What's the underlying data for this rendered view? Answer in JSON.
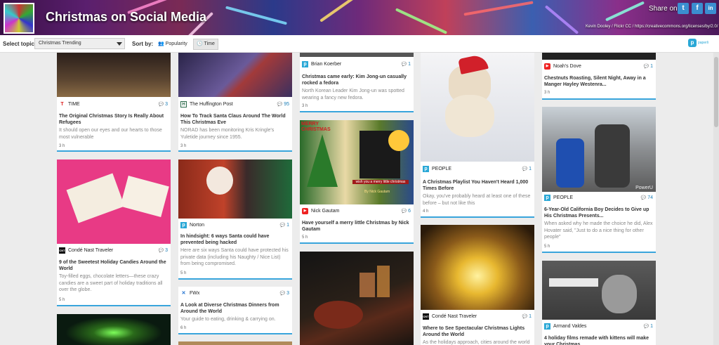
{
  "header": {
    "title": "Christmas on Social Media",
    "share_label": "Share on:",
    "share_buttons": [
      "t",
      "f",
      "in"
    ],
    "credit": "Kevin Dooley / Flickr CC / https://creativecommons.org/licenses/by/2.0/"
  },
  "controls": {
    "topic_label": "Select topic:",
    "topic_value": "Christmas Trending",
    "sort_label": "Sort by:",
    "sort_popularity": "Popularity",
    "sort_time": "Time",
    "brand": "paperli"
  },
  "cards": [
    {
      "source": "TIME",
      "count": "3",
      "title": "The Original Christmas Story Is Really About Refugees",
      "desc": "It should open our eyes and our hearts to those most vulnerable",
      "age": "3 h"
    },
    {
      "source": "The Huffington Post",
      "count": "95",
      "title": "How To Track Santa Claus Around The World This Christmas Eve",
      "desc": "NORAD has been monitoring Kris Kringle's Yuletide journey since 1955.",
      "age": "3 h"
    },
    {
      "source": "Brian Koerber",
      "count": "1",
      "title": "Christmas came early: Kim Jong-un casually rocked a fedora",
      "desc": "North Korean Leader Kim Jong-un was spotted wearing a fancy new fedora.",
      "age": "3 h"
    },
    {
      "source": "Noah's Dove",
      "count": "1",
      "title": "Chestnuts Roasting, Silent Night, Away in a Manger Hayley Westenra...",
      "desc": "",
      "age": "3 h"
    },
    {
      "source": "Condé Nast Traveler",
      "count": "3",
      "title": "9 of the Sweetest Holiday Candies Around the World",
      "desc": "Toy-filled eggs, chocolate letters—these crazy candies are a sweet part of holiday traditions all over the globe.",
      "age": "5 h"
    },
    {
      "source": "Norton",
      "count": "1",
      "title": "In hindsight: 6 ways Santa could have prevented being hacked",
      "desc": "Here are six ways Santa could have protected his private data (including his Naughty / Nice List) from being compromised.",
      "age": "5 h"
    },
    {
      "source": "FWx",
      "count": "3",
      "title": "A Look at Diverse Christmas Dinners from Around the World",
      "desc": "Your guide to eating, drinking & carrying on.",
      "age": "6 h"
    },
    {
      "source": "Nick Gautam",
      "count": "6",
      "title": "Have yourself a merry little Christmas by Nick Gautam",
      "desc": "",
      "age": "5 h"
    },
    {
      "source": "PEOPLE",
      "count": "1",
      "title": "A Christmas Playlist You Haven't Heard 1,000 Times Before",
      "desc": "Okay, you've probably heard at least one of these before – but not like this",
      "age": "4 h"
    },
    {
      "source": "Condé Nast Traveler",
      "count": "1",
      "title": "Where to See Spectacular Christmas Lights Around the World",
      "desc": "As the holidays approach, cities around the world",
      "age": ""
    },
    {
      "source": "PEOPLE",
      "count": "74",
      "title": "6-Year-Old California Boy Decides to Give up His Christmas Presents...",
      "desc": "When asked why he made the choice he did, Alex Hovater said, \"Just to do a nice thing for other people\"",
      "age": "5 h"
    },
    {
      "source": "Armand Valdes",
      "count": "1",
      "title": "4 holiday films remade with kittens will make your Christmas",
      "desc": "",
      "age": ""
    }
  ],
  "image_texts": {
    "merry_christmas": "MERRY CHRISTMAS",
    "merry_overlay": "wish you a merry little christmas",
    "merry_byline": "By Nick Gautam",
    "powerup": "PowerU"
  }
}
